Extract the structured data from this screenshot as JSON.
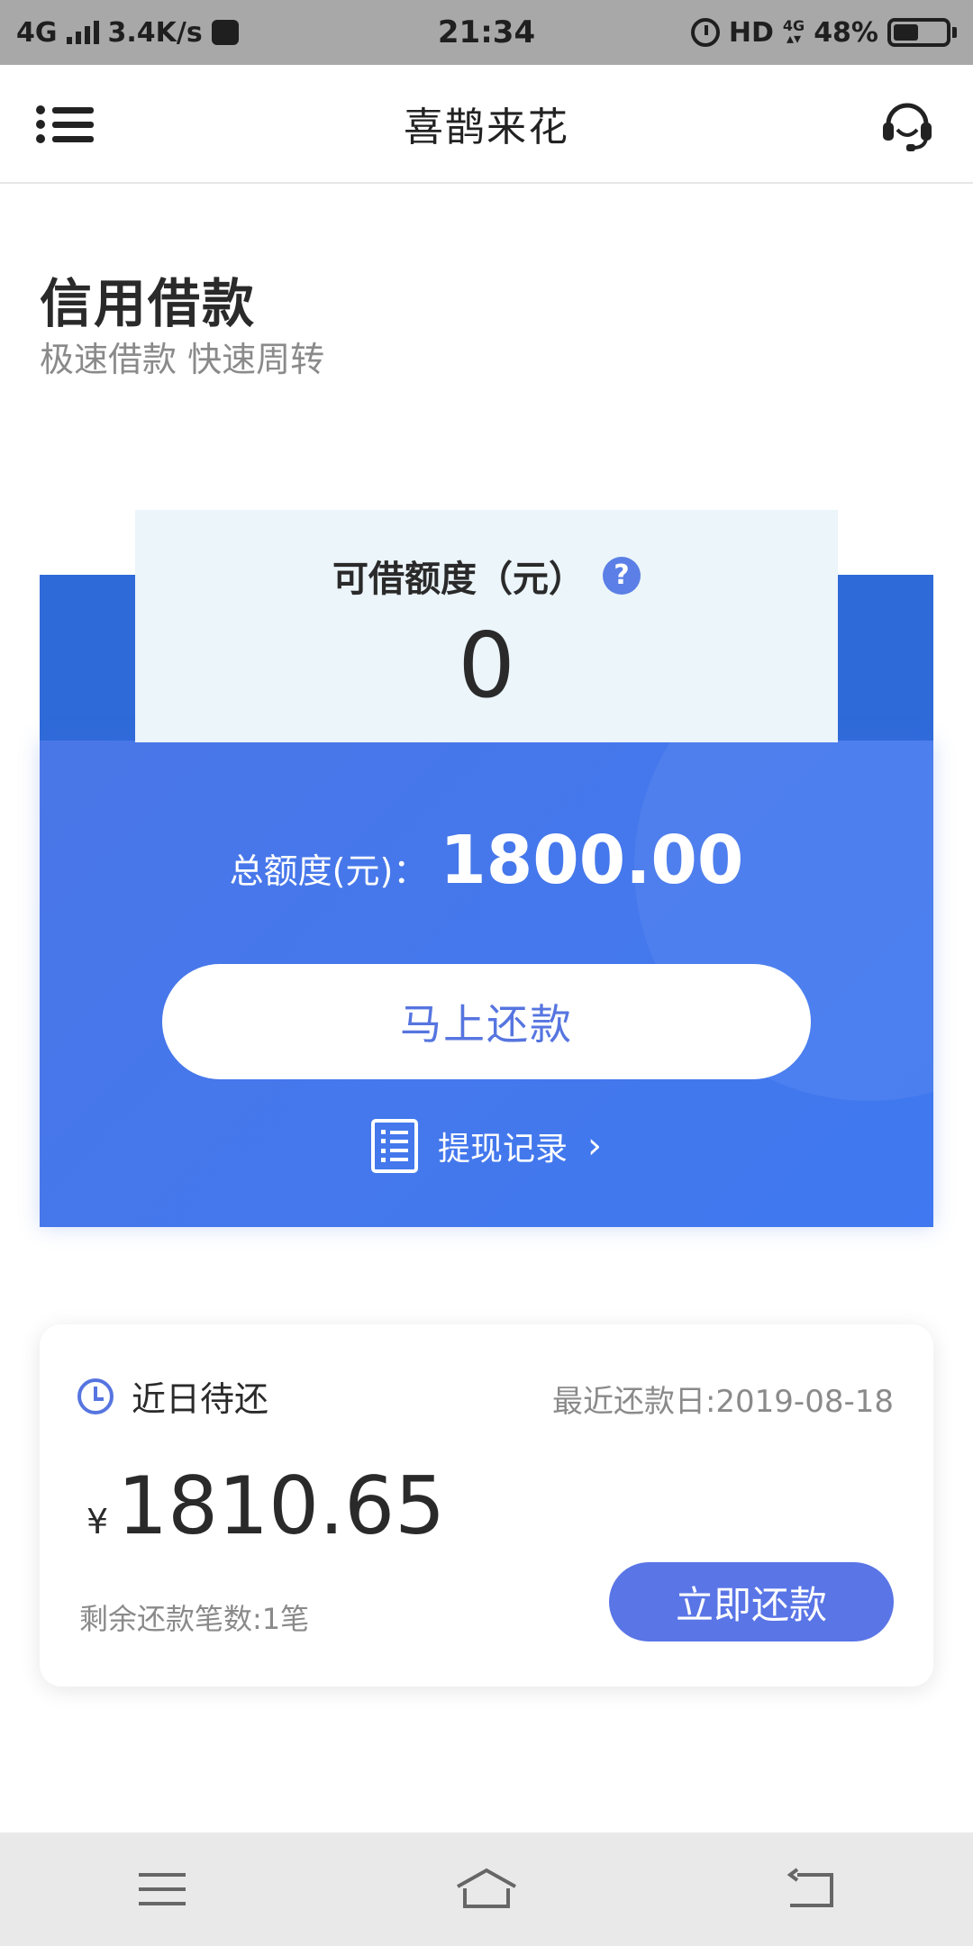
{
  "status_bar": {
    "network": "4G",
    "speed": "3.4K/s",
    "time": "21:34",
    "hd": "HD",
    "net_small": "4G",
    "battery_text": "48%",
    "battery_level": 0.48
  },
  "header": {
    "title": "喜鹊来花",
    "menu_icon": "menu-icon",
    "support_icon": "headset-icon"
  },
  "hero": {
    "title": "信用借款",
    "subtitle": "极速借款 快速周转"
  },
  "credit_card": {
    "available_label": "可借额度（元）",
    "help_symbol": "?",
    "available_value": "0",
    "total_label": "总额度(元)：",
    "total_value": "1800.00",
    "repay_button": "马上还款",
    "records_label": "提现记录",
    "records_chevron": "›"
  },
  "pending": {
    "title": "近日待还",
    "latest_date_label": "最近还款日:2019-08-18",
    "currency_symbol": "¥",
    "amount": "1810.65",
    "remaining_label": "剩余还款笔数:1笔",
    "repay_button": "立即还款"
  },
  "nav_bar": {
    "menu_icon": "menu-icon",
    "home_icon": "home-icon",
    "back_icon": "back-icon"
  },
  "colors": {
    "primary_blue": "#4a77e8",
    "button_blue": "#5a75e6",
    "status_gray": "#a8a8a8"
  }
}
